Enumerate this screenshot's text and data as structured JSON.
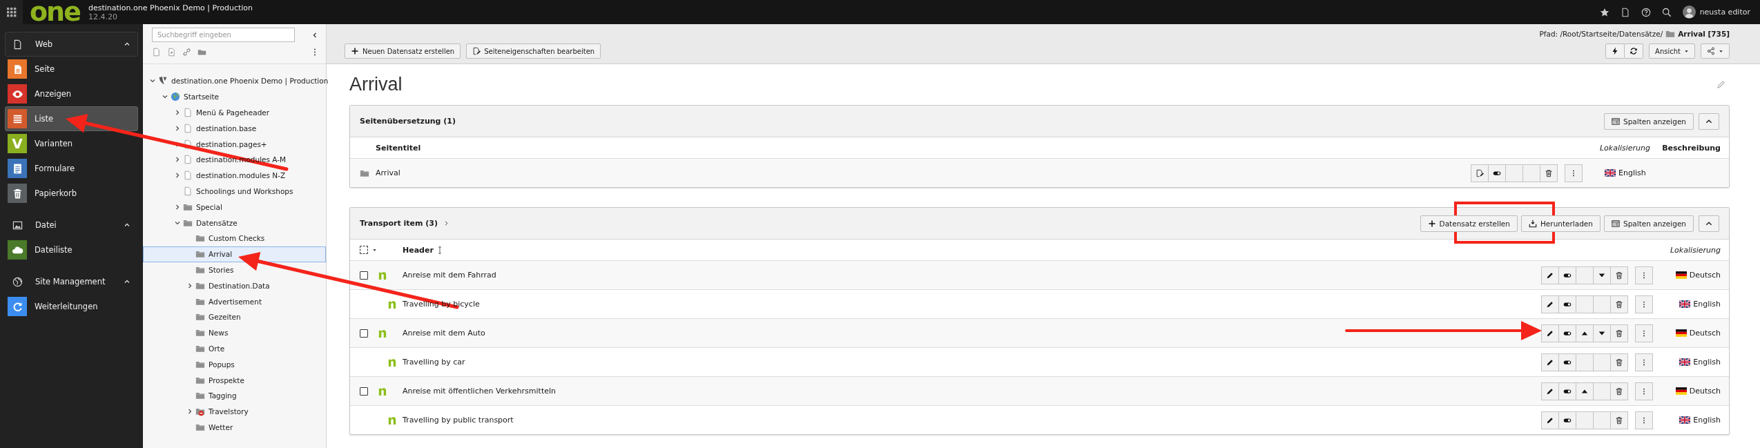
{
  "topbar": {
    "logo": "one",
    "title": "destination.one Phoenix Demo | Production",
    "version": "12.4.20",
    "user": "neusta editor"
  },
  "modules": [
    {
      "label": "Web",
      "expanded": true,
      "active": true,
      "items": [
        {
          "label": "Seite",
          "selected": false,
          "color": "#e8762d"
        },
        {
          "label": "Anzeigen",
          "selected": false,
          "color": "#d5332b"
        },
        {
          "label": "Liste",
          "selected": true,
          "color": "#d35a2c"
        },
        {
          "label": "Varianten",
          "selected": false,
          "color": "#8aaf1f",
          "glyph": "V"
        },
        {
          "label": "Formulare",
          "selected": false,
          "color": "#3b73b9"
        },
        {
          "label": "Papierkorb",
          "selected": false,
          "color": "#5a5f61"
        }
      ]
    },
    {
      "label": "Datei",
      "expanded": true,
      "active": false,
      "items": [
        {
          "label": "Dateiliste",
          "selected": false,
          "color": "#4b7b2a"
        }
      ]
    },
    {
      "label": "Site Management",
      "expanded": true,
      "active": false,
      "items": [
        {
          "label": "Weiterleitungen",
          "selected": false,
          "color": "#3b8ef0"
        }
      ]
    }
  ],
  "tree": {
    "search_placeholder": "Suchbegriff eingeben",
    "nodes": [
      {
        "label": "destination.one Phoenix Demo | Production",
        "kind": "site",
        "expanded": true,
        "selected": false,
        "children": [
          {
            "label": "Startseite",
            "kind": "home",
            "expanded": true,
            "selected": false,
            "children": [
              {
                "label": "Menü & Pageheader",
                "kind": "page",
                "expanded": false,
                "selected": false
              },
              {
                "label": "destination.base",
                "kind": "page",
                "expanded": false,
                "selected": false
              },
              {
                "label": "destination.pages+",
                "kind": "page",
                "expanded": false,
                "selected": false
              },
              {
                "label": "destination.modules A-M",
                "kind": "page",
                "expanded": false,
                "selected": false
              },
              {
                "label": "destination.modules N-Z",
                "kind": "page",
                "expanded": false,
                "selected": false
              },
              {
                "label": "Schoolings und Workshops",
                "kind": "page",
                "selected": false
              },
              {
                "label": "Special",
                "kind": "folder",
                "expanded": false,
                "selected": false
              },
              {
                "label": "Datensätze",
                "kind": "folder",
                "expanded": true,
                "selected": false,
                "children": [
                  {
                    "label": "Custom Checks",
                    "kind": "folder",
                    "selected": false
                  },
                  {
                    "label": "Arrival",
                    "kind": "folder",
                    "selected": true
                  },
                  {
                    "label": "Stories",
                    "kind": "folder",
                    "selected": false
                  },
                  {
                    "label": "Destination.Data",
                    "kind": "folder",
                    "expanded": false,
                    "selected": false
                  },
                  {
                    "label": "Advertisement",
                    "kind": "folder",
                    "selected": false
                  },
                  {
                    "label": "Gezeiten",
                    "kind": "folder",
                    "selected": false
                  },
                  {
                    "label": "News",
                    "kind": "folder",
                    "selected": false
                  },
                  {
                    "label": "Orte",
                    "kind": "folder",
                    "selected": false
                  },
                  {
                    "label": "Popups",
                    "kind": "folder",
                    "selected": false
                  },
                  {
                    "label": "Prospekte",
                    "kind": "folder",
                    "selected": false
                  },
                  {
                    "label": "Tagging",
                    "kind": "folder",
                    "selected": false
                  },
                  {
                    "label": "Travelstory",
                    "kind": "folder-restricted",
                    "expanded": false,
                    "selected": false
                  },
                  {
                    "label": "Wetter",
                    "kind": "folder",
                    "selected": false
                  }
                ]
              }
            ]
          }
        ]
      }
    ]
  },
  "docheader": {
    "buttons": [
      {
        "label": "Neuen Datensatz erstellen",
        "kind": "new"
      },
      {
        "label": "Seiteneigenschaften bearbeiten",
        "kind": "edit-page"
      }
    ],
    "path_prefix": "Pfad: /Root/Startseite/Datensätze/",
    "path_current": "Arrival [735]",
    "view_label": "Ansicht"
  },
  "page_title": "Arrival",
  "panels": [
    {
      "kind": "translation",
      "title": "Seitenübersetzung (1)",
      "expanded": true,
      "actions": [
        {
          "label": "Spalten anzeigen",
          "kind": "columns"
        }
      ],
      "columns": [
        {
          "label": "Seitentitel",
          "kind": "title"
        },
        {
          "label": "Lokalisierung",
          "kind": "localization"
        },
        {
          "label": "Beschreibung",
          "kind": "field"
        }
      ],
      "rows": [
        {
          "title": "Arrival",
          "move_up": false,
          "move_down": false,
          "language": {
            "kind": "gb",
            "label": "English"
          }
        }
      ]
    },
    {
      "kind": "records",
      "title": "Transport item (3)",
      "expanded": true,
      "actions": [
        {
          "label": "Datensatz erstellen",
          "kind": "new"
        },
        {
          "label": "Herunterladen",
          "kind": "download"
        },
        {
          "label": "Spalten anzeigen",
          "kind": "columns"
        }
      ],
      "select_all": {
        "checked": false
      },
      "columns": [
        {
          "label": "Header",
          "kind": "title"
        },
        {
          "label": "Lokalisierung",
          "kind": "localization"
        }
      ],
      "rows": [
        {
          "title": "Anreise mit dem Fahrrad",
          "translation": false,
          "checked": false,
          "move_up": false,
          "move_down": true,
          "language": {
            "kind": "de",
            "label": "Deutsch"
          }
        },
        {
          "title": "Travelling by bicycle",
          "translation": true,
          "move_up": false,
          "move_down": false,
          "language": {
            "kind": "gb",
            "label": "English"
          }
        },
        {
          "title": "Anreise mit dem Auto",
          "translation": false,
          "checked": false,
          "move_up": true,
          "move_down": true,
          "language": {
            "kind": "de",
            "label": "Deutsch"
          }
        },
        {
          "title": "Travelling by car",
          "translation": true,
          "move_up": false,
          "move_down": false,
          "language": {
            "kind": "gb",
            "label": "English"
          }
        },
        {
          "title": "Anreise mit öffentlichen Verkehrsmitteln",
          "translation": false,
          "checked": false,
          "move_up": true,
          "move_down": false,
          "language": {
            "kind": "de",
            "label": "Deutsch"
          }
        },
        {
          "title": "Travelling by public transport",
          "translation": true,
          "move_up": false,
          "move_down": false,
          "language": {
            "kind": "gb",
            "label": "English"
          }
        }
      ]
    }
  ]
}
